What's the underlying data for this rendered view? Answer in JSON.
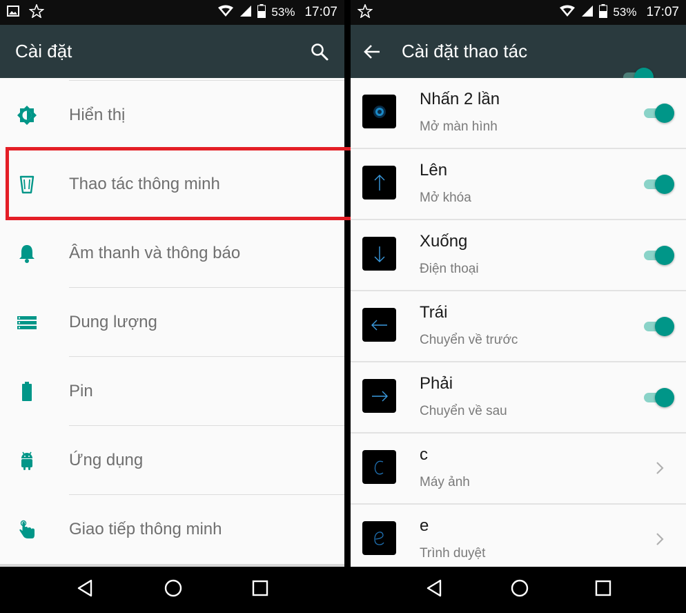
{
  "colors": {
    "accent": "#009688",
    "appbar": "#2a3a3e",
    "highlight": "#e41e26"
  },
  "status": {
    "battery": "53%",
    "time": "17:07"
  },
  "left": {
    "title": "Cài đặt",
    "search_icon": "search-icon",
    "items": [
      {
        "label": "Hiển thị",
        "icon": "brightness-icon"
      },
      {
        "label": "Thao tác thông minh",
        "icon": "smart-gesture-icon"
      },
      {
        "label": "Âm thanh và thông báo",
        "icon": "bell-icon"
      },
      {
        "label": "Dung lượng",
        "icon": "storage-icon"
      },
      {
        "label": "Pin",
        "icon": "battery-icon"
      },
      {
        "label": "Ứng dụng",
        "icon": "android-icon"
      },
      {
        "label": "Giao tiếp thông minh",
        "icon": "hand-touch-icon"
      }
    ]
  },
  "right": {
    "title": "Cài đặt thao tác",
    "master_toggle": true,
    "gestures": [
      {
        "name": "Nhấn 2 lần",
        "action": "Mở màn hình",
        "icon": "double-tap-icon",
        "control": "toggle",
        "on": true
      },
      {
        "name": "Lên",
        "action": "Mở khóa",
        "icon": "arrow-up-icon",
        "control": "toggle",
        "on": true
      },
      {
        "name": "Xuống",
        "action": "Điện thoại",
        "icon": "arrow-down-icon",
        "control": "toggle",
        "on": true
      },
      {
        "name": "Trái",
        "action": "Chuyển về trước",
        "icon": "arrow-left-icon",
        "control": "toggle",
        "on": true
      },
      {
        "name": "Phải",
        "action": "Chuyển về sau",
        "icon": "arrow-right-icon",
        "control": "toggle",
        "on": true
      },
      {
        "name": "c",
        "action": "Máy ảnh",
        "icon": "letter-c-icon",
        "control": "chevron"
      },
      {
        "name": "e",
        "action": "Trình duyệt",
        "icon": "letter-e-icon",
        "control": "chevron"
      }
    ]
  }
}
